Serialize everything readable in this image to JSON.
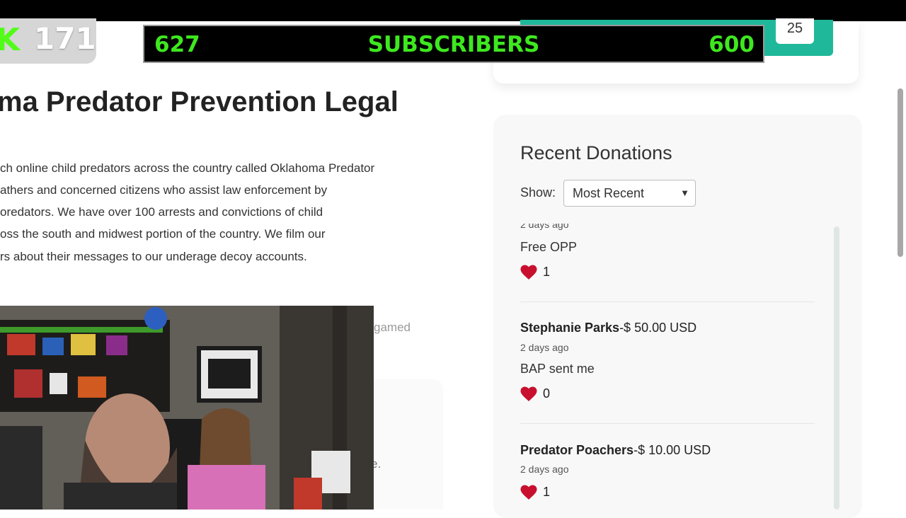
{
  "overlay": {
    "kick_count": "171",
    "subs_current": "627",
    "subs_label": "SUBSCRIBERS",
    "subs_goal": "600",
    "badge_count": "25",
    "kick_color": "#53fc18",
    "sub_text_color": "#3ee81f"
  },
  "campaign": {
    "title": "ma Predator Prevention Legal",
    "description_lines": [
      "ch online child predators across the country called Oklahoma Predator",
      "athers and concerned citizens who assist law enforcement by",
      "oredators. We have over 100 arrests and convictions of child",
      "oss the south and midwest portion of the country. We film our",
      "rs about their messages to our underage decoy accounts."
    ],
    "faded_text": "gamed",
    "faded_dot": "e."
  },
  "donations": {
    "title": "Recent Donations",
    "show_label": "Show:",
    "sort_selected": "Most Recent",
    "accent_color": "#20b89a",
    "heart_color": "#c8102e",
    "items": [
      {
        "name": "",
        "amount": "",
        "date": "2 days ago",
        "message": "Free OPP",
        "likes": "1"
      },
      {
        "name": "Stephanie Parks",
        "amount": "-$ 50.00 USD",
        "date": "2 days ago",
        "message": "BAP sent me",
        "likes": "0"
      },
      {
        "name": "Predator Poachers",
        "amount": "-$ 10.00 USD",
        "date": "2 days ago",
        "message": "",
        "likes": "1"
      }
    ]
  }
}
